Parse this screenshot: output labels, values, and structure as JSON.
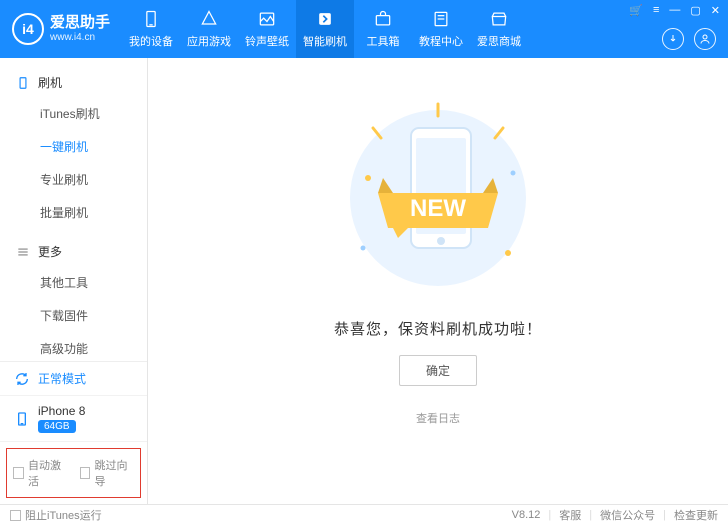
{
  "app": {
    "title": "爱思助手",
    "subtitle": "www.i4.cn",
    "version": "V8.12"
  },
  "nav": [
    {
      "label": "我的设备"
    },
    {
      "label": "应用游戏"
    },
    {
      "label": "铃声壁纸"
    },
    {
      "label": "智能刷机"
    },
    {
      "label": "工具箱"
    },
    {
      "label": "教程中心"
    },
    {
      "label": "爱思商城"
    }
  ],
  "sidebar": {
    "sections": [
      {
        "head": "刷机",
        "items": [
          "iTunes刷机",
          "一键刷机",
          "专业刷机",
          "批量刷机"
        ]
      },
      {
        "head": "更多",
        "items": [
          "其他工具",
          "下载固件",
          "高级功能"
        ]
      }
    ],
    "mode": "正常模式",
    "device": {
      "name": "iPhone 8",
      "storage": "64GB"
    },
    "checks": {
      "autoActivate": "自动激活",
      "skipGuide": "跳过向导"
    }
  },
  "main": {
    "banner": "NEW",
    "successTitle": "恭喜您，保资料刷机成功啦！",
    "okButton": "确定",
    "viewLog": "查看日志"
  },
  "statusbar": {
    "blockItunes": "阻止iTunes运行",
    "support": "客服",
    "wechat": "微信公众号",
    "checkUpdate": "检查更新"
  }
}
